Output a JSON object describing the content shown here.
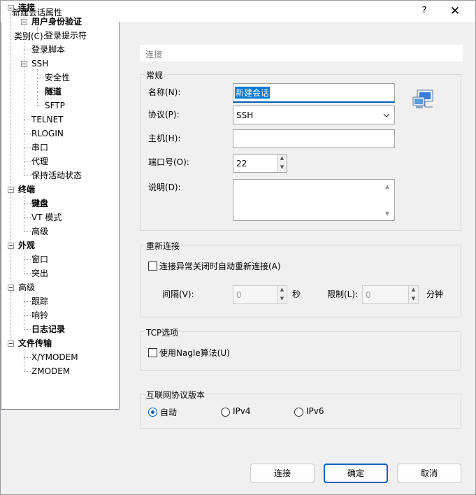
{
  "window": {
    "title": "新建会话属性",
    "help_icon": "?",
    "close_icon": "✕"
  },
  "category": {
    "label": "类别(C):",
    "tree": [
      {
        "label": "连接",
        "bold": true
      },
      {
        "label": "用户身份验证",
        "bold": true
      },
      {
        "label": "登录提示符",
        "bold": false
      },
      {
        "label": "登录脚本",
        "bold": false
      },
      {
        "label": "SSH",
        "bold": false
      },
      {
        "label": "安全性",
        "bold": false
      },
      {
        "label": "隧道",
        "bold": true
      },
      {
        "label": "SFTP",
        "bold": false
      },
      {
        "label": "TELNET",
        "bold": false
      },
      {
        "label": "RLOGIN",
        "bold": false
      },
      {
        "label": "串口",
        "bold": false
      },
      {
        "label": "代理",
        "bold": false
      },
      {
        "label": "保持活动状态",
        "bold": false
      },
      {
        "label": "终端",
        "bold": true
      },
      {
        "label": "键盘",
        "bold": true
      },
      {
        "label": "VT 模式",
        "bold": false
      },
      {
        "label": "高级",
        "bold": false
      },
      {
        "label": "外观",
        "bold": true
      },
      {
        "label": "窗口",
        "bold": false
      },
      {
        "label": "突出",
        "bold": false
      },
      {
        "label": "高级",
        "bold": false
      },
      {
        "label": "跟踪",
        "bold": false
      },
      {
        "label": "响铃",
        "bold": false
      },
      {
        "label": "日志记录",
        "bold": true
      },
      {
        "label": "文件传输",
        "bold": true
      },
      {
        "label": "X/YMODEM",
        "bold": false
      },
      {
        "label": "ZMODEM",
        "bold": false
      }
    ]
  },
  "section_header": "连接",
  "general": {
    "title": "常规",
    "name_label": "名称(N):",
    "name_value": "新建会话",
    "protocol_label": "协议(P):",
    "protocol_value": "SSH",
    "host_label": "主机(H):",
    "host_value": "",
    "port_label": "端口号(O):",
    "port_value": "22",
    "desc_label": "说明(D):",
    "desc_value": ""
  },
  "reconnect": {
    "title": "重新连接",
    "checkbox_label": "连接异常关闭时自动重新连接(A)",
    "interval_label": "间隔(V):",
    "interval_value": "0",
    "interval_unit": "秒",
    "limit_label": "限制(L):",
    "limit_value": "0",
    "limit_unit": "分钟"
  },
  "tcp": {
    "title": "TCP选项",
    "nagle_label": "使用Nagle算法(U)"
  },
  "ip_version": {
    "title": "互联网协议版本",
    "options": [
      "自动",
      "IPv4",
      "IPv6"
    ],
    "selected": "自动"
  },
  "buttons": {
    "connect": "连接",
    "ok": "确定",
    "cancel": "取消"
  }
}
